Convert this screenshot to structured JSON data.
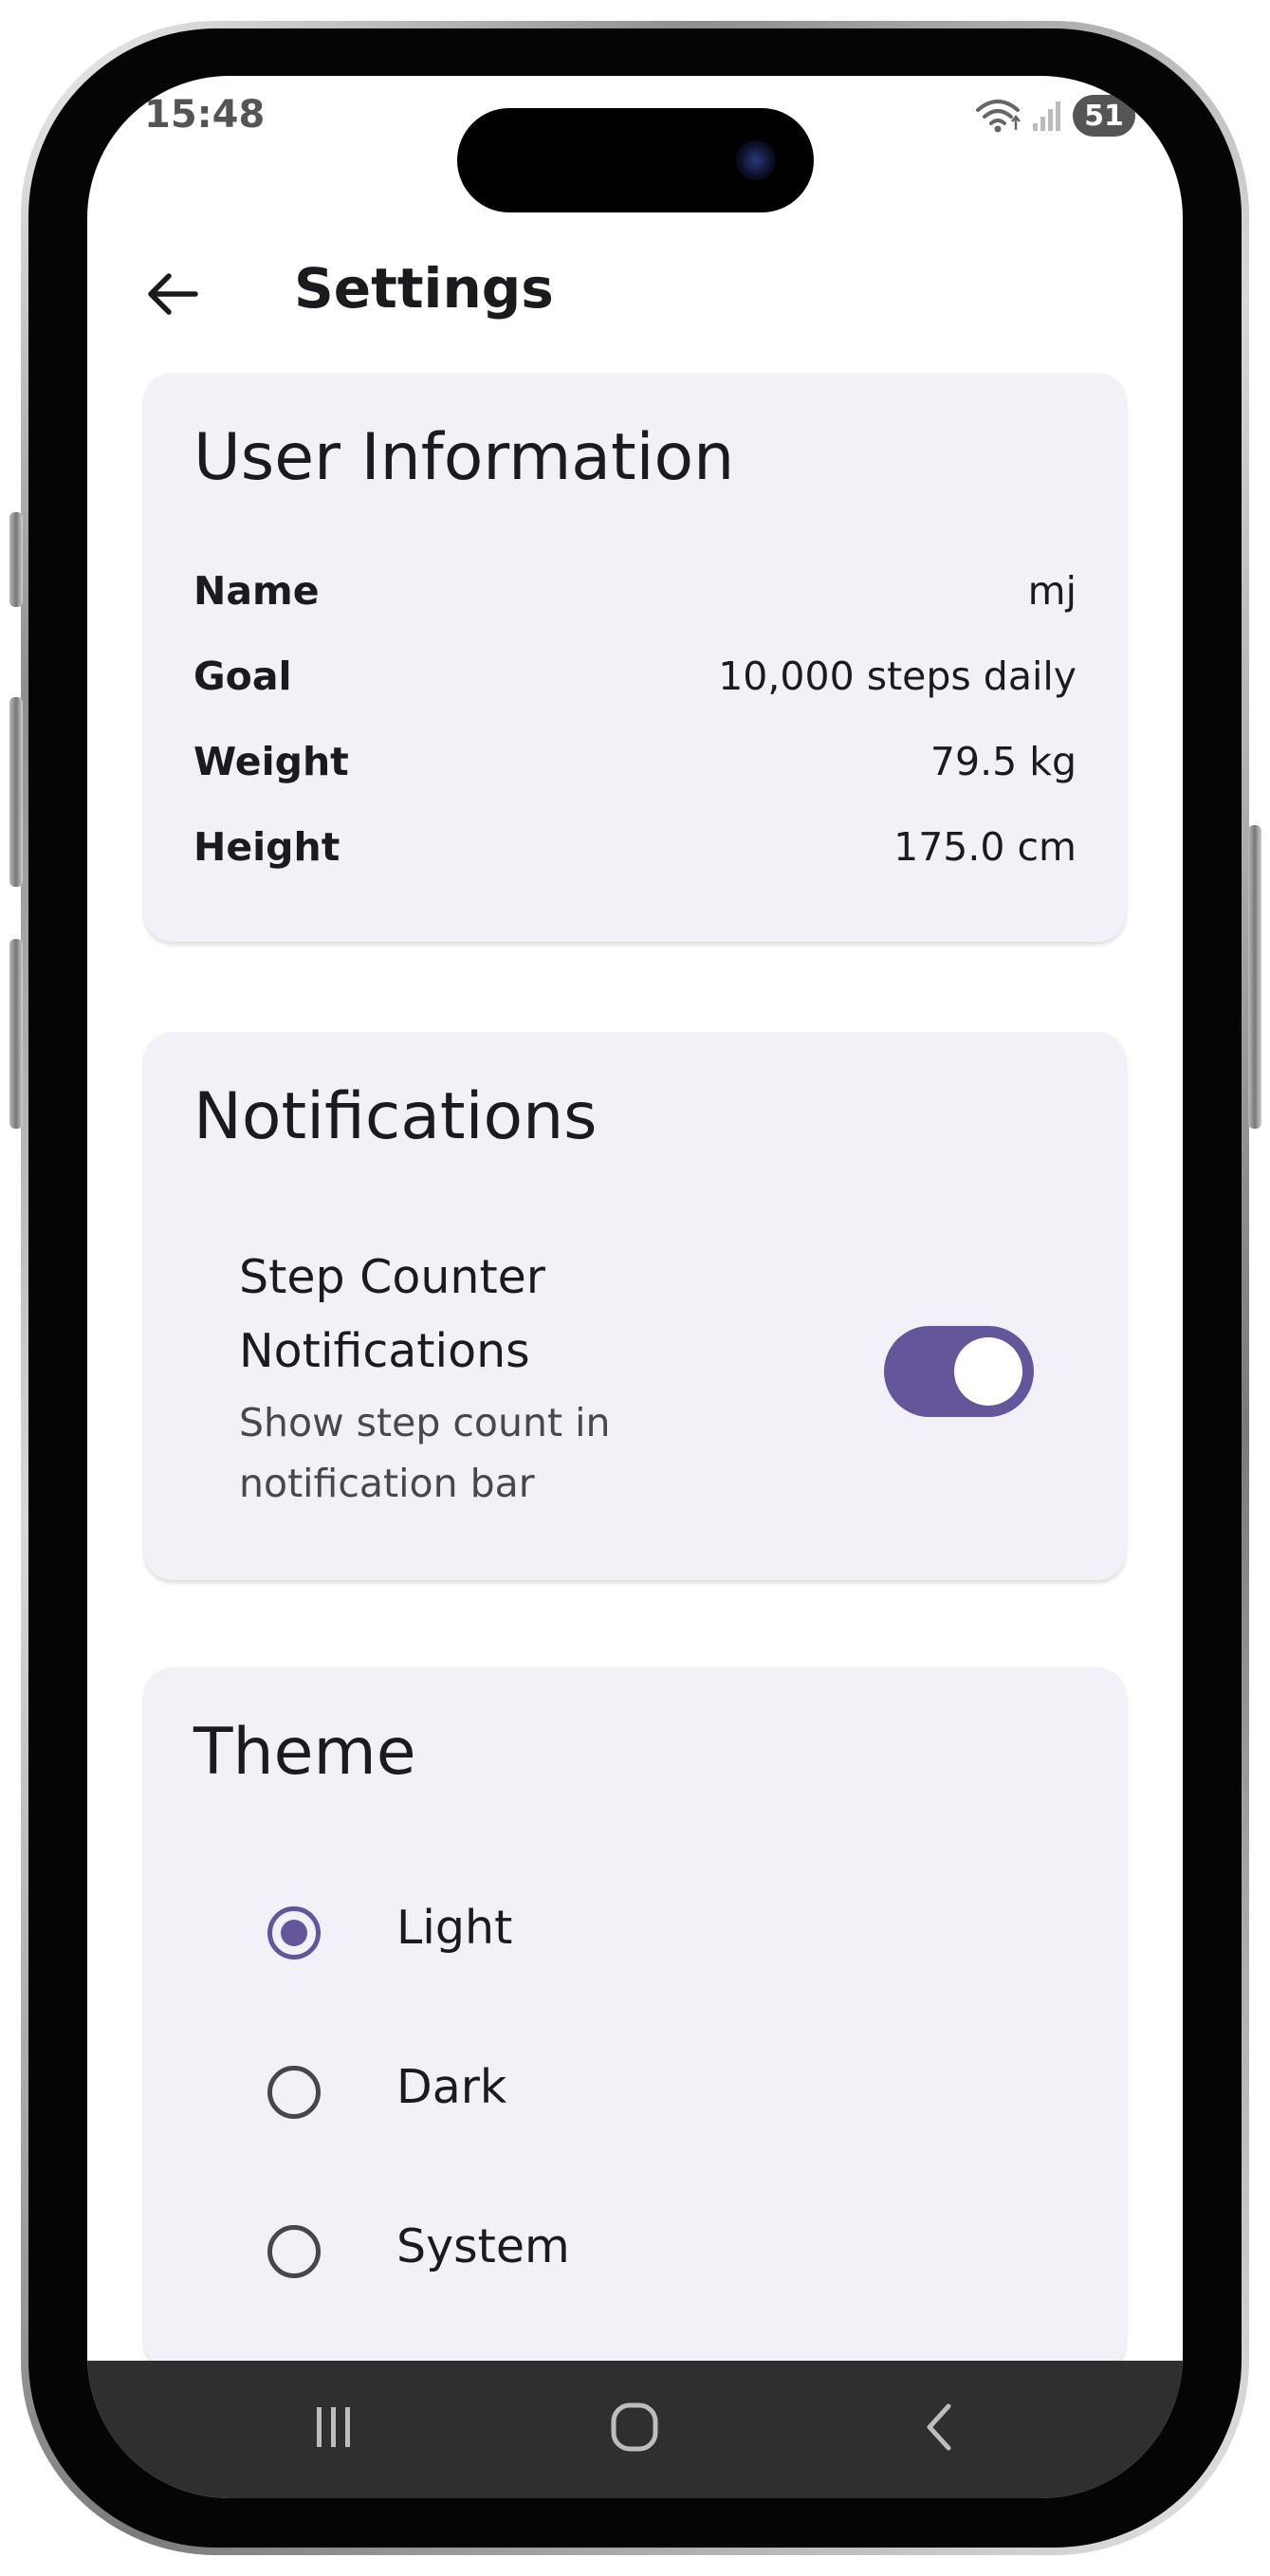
{
  "status_bar": {
    "time": "15:48",
    "battery": "51"
  },
  "app_bar": {
    "title": "Settings"
  },
  "user_information": {
    "title": "User Information",
    "rows": [
      {
        "label": "Name",
        "value": "mj"
      },
      {
        "label": "Goal",
        "value": "10,000 steps daily"
      },
      {
        "label": "Weight",
        "value": "79.5 kg"
      },
      {
        "label": "Height",
        "value": "175.0 cm"
      }
    ]
  },
  "notifications": {
    "title": "Notifications",
    "item_title": "Step Counter Notifications",
    "item_subtitle": "Show step count in notification bar",
    "enabled": true
  },
  "theme": {
    "title": "Theme",
    "options": [
      {
        "label": "Light",
        "selected": true
      },
      {
        "label": "Dark",
        "selected": false
      },
      {
        "label": "System",
        "selected": false
      }
    ]
  },
  "colors": {
    "accent": "#65559b",
    "card_background": "#f3f0f7",
    "nav_bar": "#2f2f2f"
  },
  "icons": {
    "back": "arrow-left-icon",
    "nav_recents": "recents-icon",
    "nav_home": "home-icon",
    "nav_back": "chevron-left-icon"
  }
}
